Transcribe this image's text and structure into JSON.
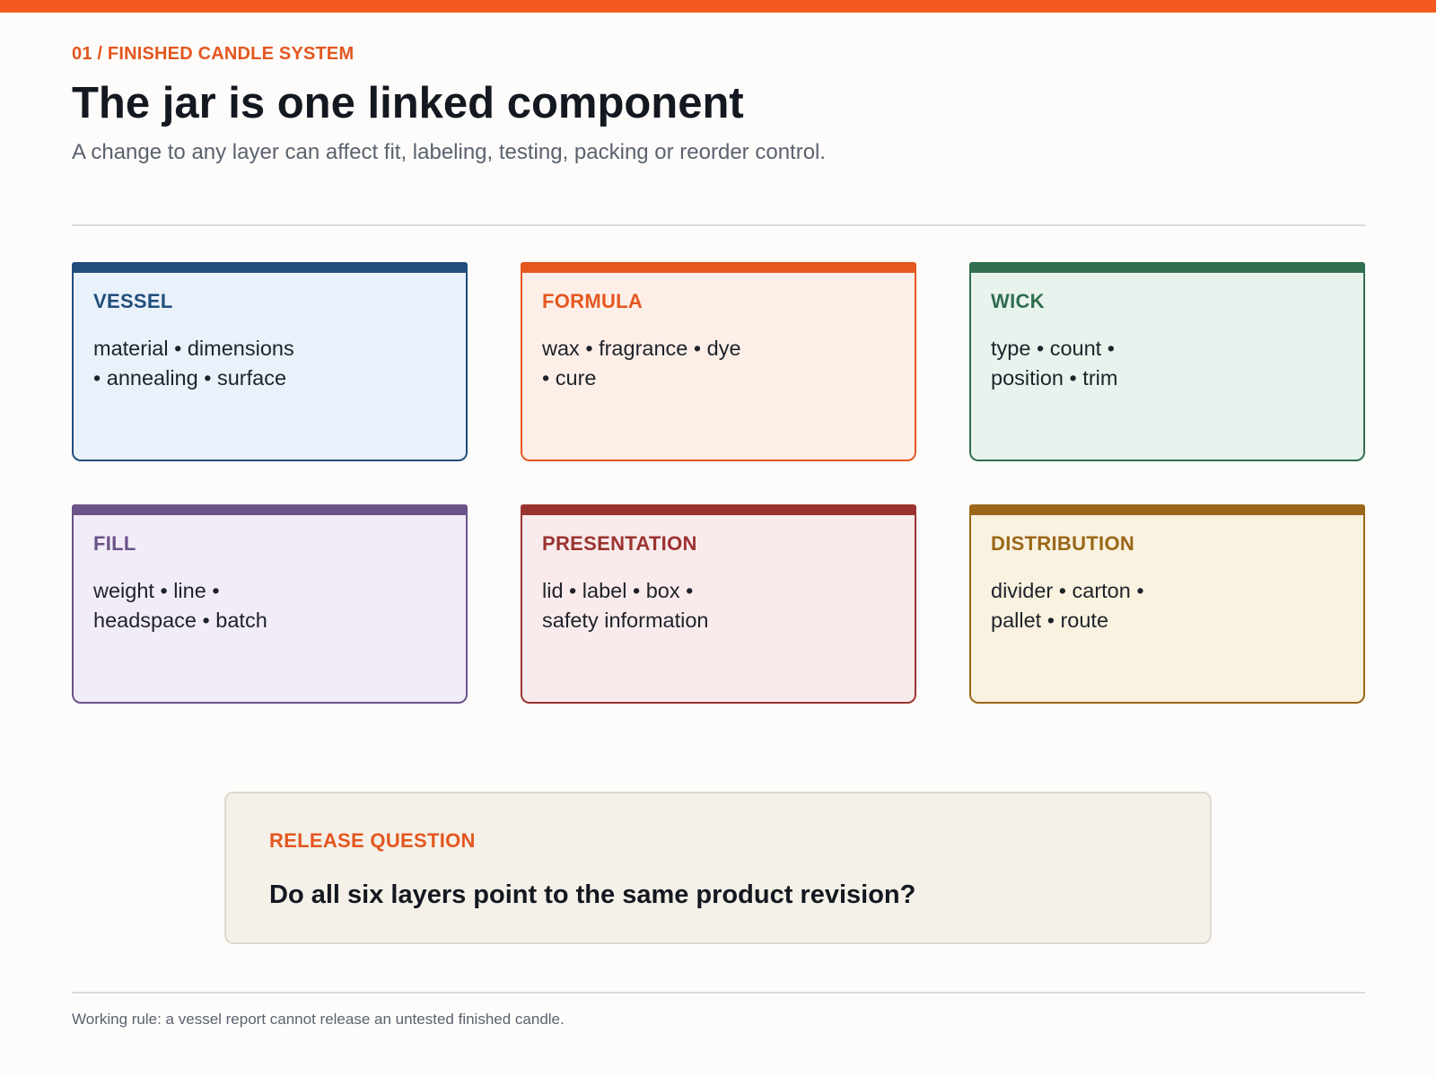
{
  "header": {
    "eyebrow": "01 / FINISHED CANDLE SYSTEM",
    "title": "The jar is one linked component",
    "subtitle": "A change to any layer can affect fit, labeling, testing, packing or reorder control."
  },
  "layers": [
    {
      "label": "VESSEL",
      "line1": "material • dimensions",
      "line2": "• annealing • surface",
      "color": "#1f4e7c"
    },
    {
      "label": "FORMULA",
      "line1": "wax • fragrance • dye",
      "line2": "• cure",
      "color": "#e4571f"
    },
    {
      "label": "WICK",
      "line1": "type • count •",
      "line2": "position • trim",
      "color": "#2f6e4f"
    },
    {
      "label": "FILL",
      "line1": "weight • line •",
      "line2": "headspace • batch",
      "color": "#6b5288"
    },
    {
      "label": "PRESENTATION",
      "line1": "lid • label • box •",
      "line2": "safety information",
      "color": "#9a3330"
    },
    {
      "label": "DISTRIBUTION",
      "line1": "divider • carton •",
      "line2": "pallet • route",
      "color": "#9a6718"
    }
  ],
  "release": {
    "label": "RELEASE QUESTION",
    "question": "Do all six layers point to the same product revision?"
  },
  "footer": {
    "note": "Working rule: a vessel report cannot release an untested finished candle."
  },
  "colors": {
    "accent": "#f45a1f"
  }
}
